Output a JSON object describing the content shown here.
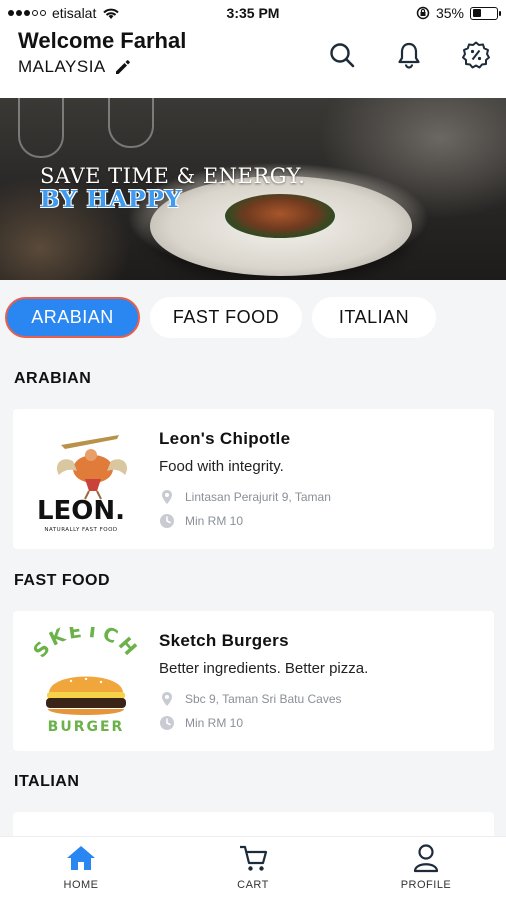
{
  "status_bar": {
    "carrier": "etisalat",
    "time": "3:35 PM",
    "battery": "35%",
    "battery_level": 0.35,
    "icons": [
      "signal-icon",
      "wifi-icon",
      "orientation-lock-icon",
      "battery-icon"
    ]
  },
  "header": {
    "welcome": "Welcome Farhal",
    "location": "MALAYSIA",
    "icons": [
      "edit-icon",
      "search-icon",
      "bell-icon",
      "discount-icon"
    ]
  },
  "banner": {
    "line1": "SAVE TIME & ENERGY.",
    "line2": "BY HAPPY"
  },
  "categories": {
    "tabs": [
      {
        "label": "ARABIAN",
        "active": true
      },
      {
        "label": "FAST FOOD",
        "active": false
      },
      {
        "label": "ITALIAN",
        "active": false
      }
    ]
  },
  "sections": [
    {
      "title": "ARABIAN",
      "restaurant": {
        "name": "Leon's Chipotle",
        "tagline": "Food with integrity.",
        "address": "Lintasan Perajurit 9, Taman",
        "min_order": "Min RM 10",
        "logo_text": "LEON.",
        "logo_subtext": "NATURALLY FAST FOOD"
      }
    },
    {
      "title": "FAST FOOD",
      "restaurant": {
        "name": "Sketch Burgers",
        "tagline": "Better ingredients. Better pizza.",
        "address": "Sbc 9, Taman Sri Batu Caves",
        "min_order": "Min RM 10",
        "logo_text": "SKETCH",
        "logo_subtext": "BURGER"
      }
    },
    {
      "title": "ITALIAN"
    }
  ],
  "tab_bar": {
    "items": [
      {
        "label": "HOME",
        "icon": "home-icon",
        "active": true
      },
      {
        "label": "CART",
        "icon": "cart-icon",
        "active": false
      },
      {
        "label": "PROFILE",
        "icon": "profile-icon",
        "active": false
      }
    ]
  },
  "colors": {
    "accent": "#2a86f0",
    "active_chip_border": "#e8604c",
    "banner_highlight": "#3f9bf0",
    "background": "#f4f5f7"
  }
}
